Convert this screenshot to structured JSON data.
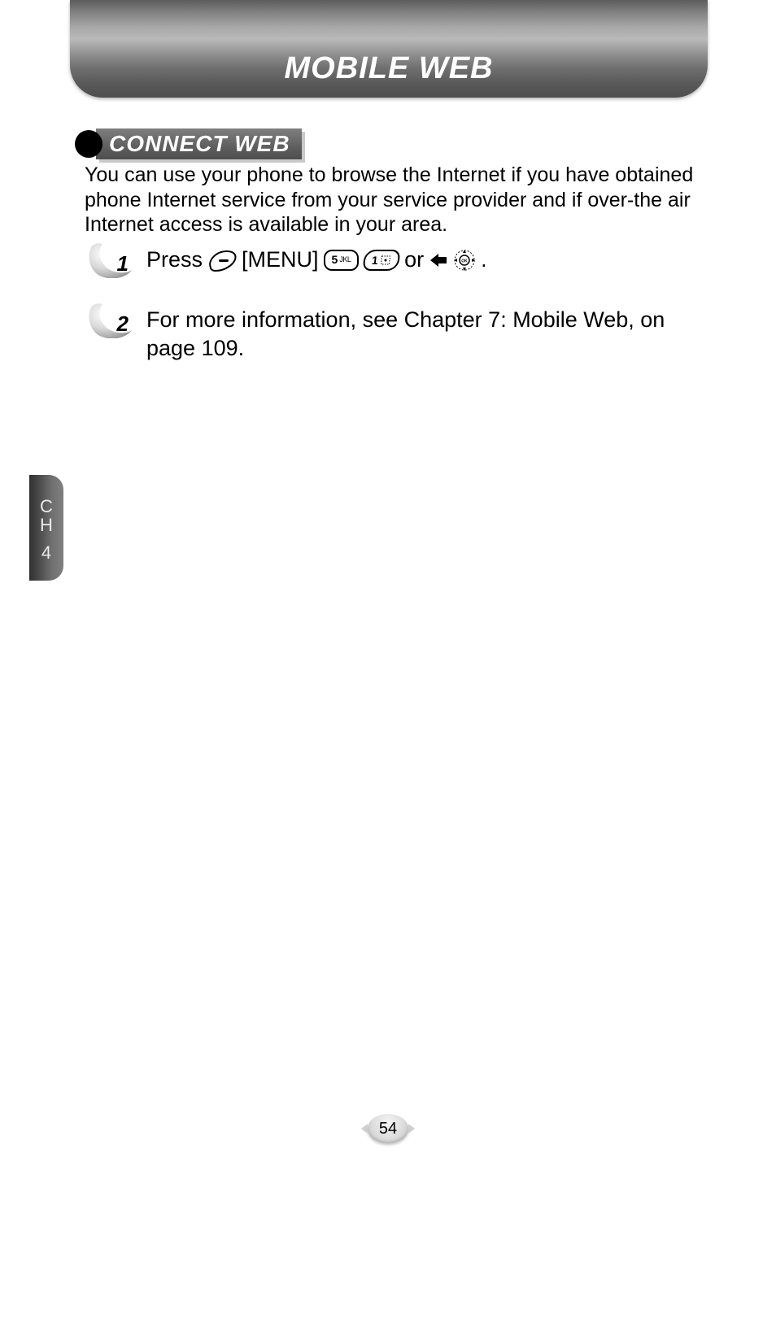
{
  "header": {
    "title": "MOBILE WEB"
  },
  "section": {
    "heading": "CONNECT WEB"
  },
  "intro": "You can use your phone to browse the Internet if you have obtained phone Internet service from your service provider and if over-the air Internet access is available in your area.",
  "steps": [
    {
      "num": "1",
      "press": "Press",
      "menu": "[MENU]",
      "key5_main": "5",
      "key5_sub": "JKL",
      "key1_main": "1",
      "or": "or",
      "period": "."
    },
    {
      "num": "2",
      "text": "For more information, see Chapter 7: Mobile Web, on page 109."
    }
  ],
  "chapter_tab": {
    "c": "C",
    "h": "H",
    "n": "4"
  },
  "page_number": "54"
}
